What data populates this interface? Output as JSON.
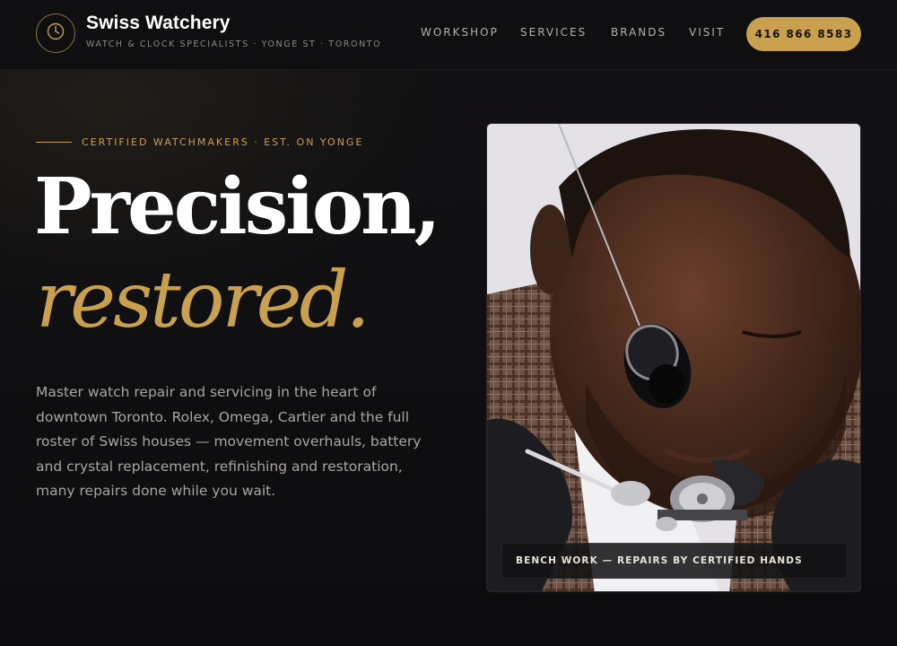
{
  "brand": {
    "name": "Swiss Watchery",
    "tagline": "WATCH & CLOCK SPECIALISTS · YONGE ST · TORONTO",
    "logo_icon": "clock-icon"
  },
  "nav": {
    "items": [
      {
        "label": "WORKSHOP"
      },
      {
        "label": "SERVICES"
      },
      {
        "label": "BRANDS"
      },
      {
        "label": "VISIT"
      }
    ],
    "phone_label": "416 866 8583"
  },
  "hero": {
    "eyebrow": "CERTIFIED WATCHMAKERS · EST. ON YONGE",
    "headline_line1": "Precision,",
    "headline_line2": "restored.",
    "body": "Master watch repair and servicing in the heart of downtown Toronto. Rolex, Omega, Cartier and the full roster of Swiss houses — movement overhauls, battery and crystal replacement, refinishing and restoration, many repairs done while you wait.",
    "image_caption": "BENCH WORK — REPAIRS BY CERTIFIED HANDS"
  },
  "colors": {
    "accent": "#c9a14e",
    "background": "#0c0c0e",
    "text": "#ffffff",
    "muted": "#a9a6a0"
  }
}
